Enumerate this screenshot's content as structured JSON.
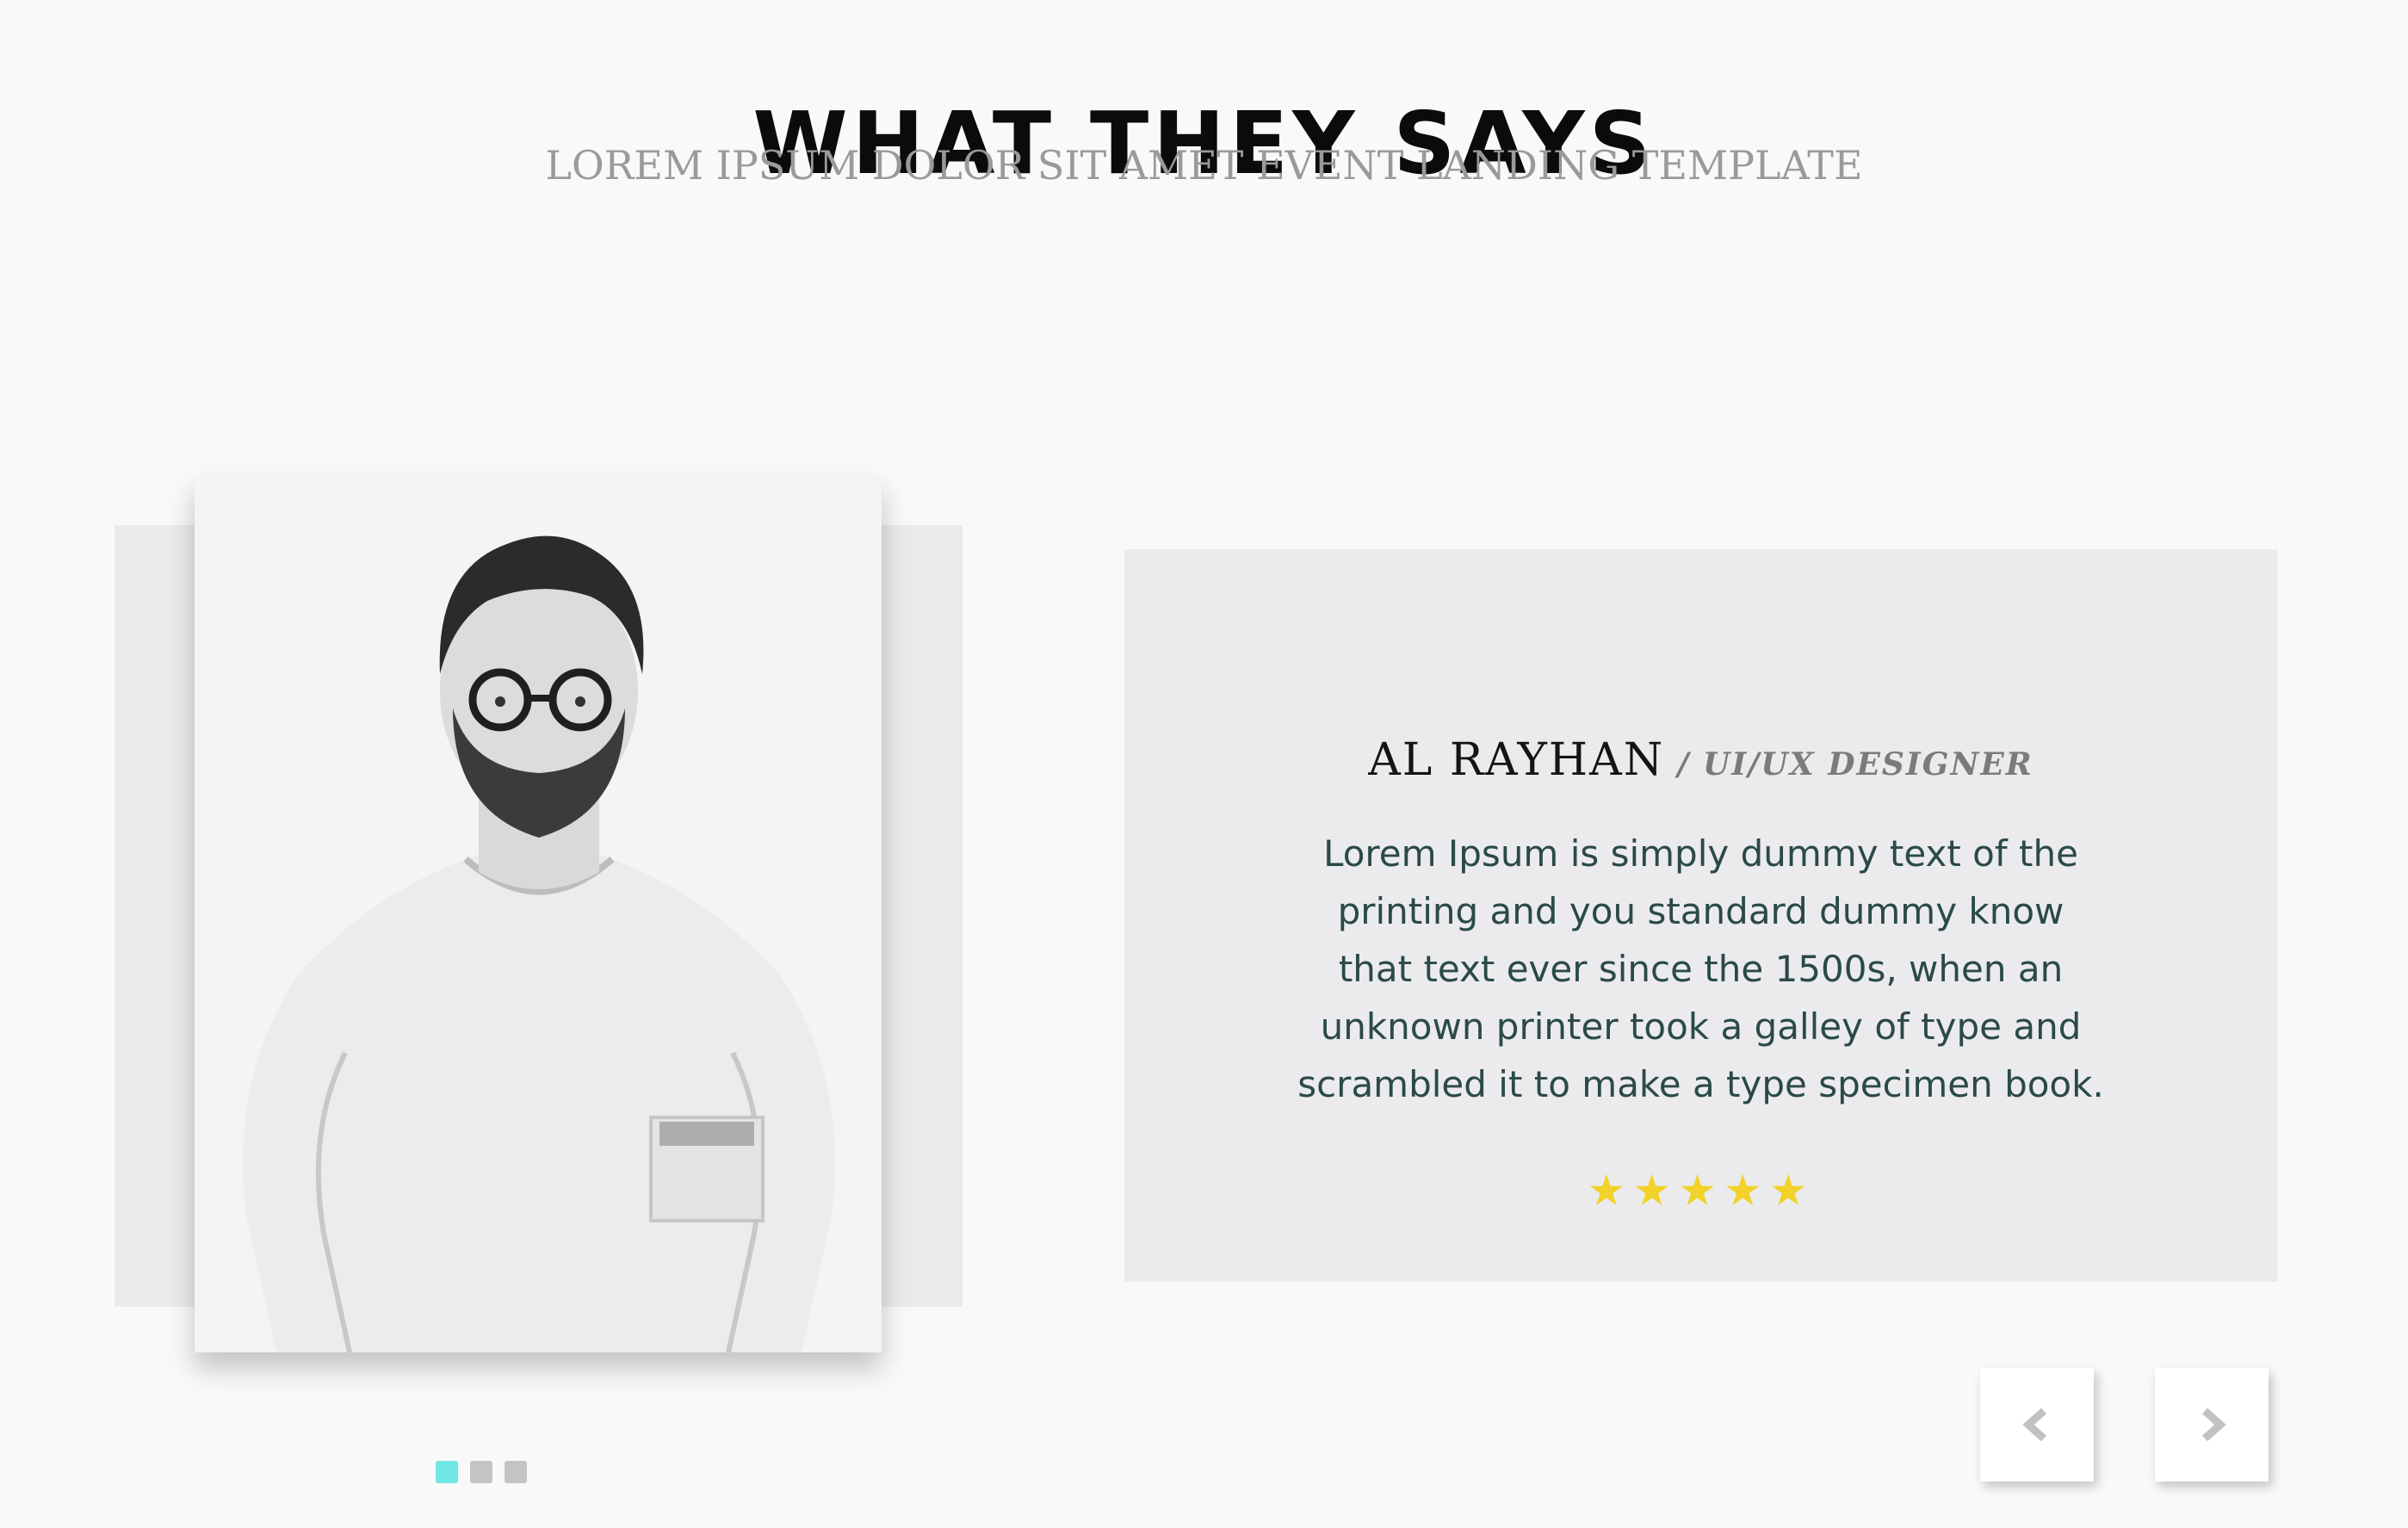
{
  "section": {
    "title": "WHAT THEY SAYS",
    "subtitle": "LOREM IPSUM DOLOR SIT AMET EVENT LANDING TEMPLATE"
  },
  "testimonial": {
    "name": "AL RAYHAN",
    "role": "/ UI/UX DESIGNER",
    "text": "Lorem Ipsum is simply dummy text of the printing and you standard dummy know that text ever since the 1500s, when an unknown printer took a galley of type and scrambled it to make a type specimen book.",
    "rating": 5,
    "stars_display": "★★★★★",
    "photo": "portrait-photo"
  },
  "slider": {
    "pages": 3,
    "active_page": 1
  },
  "controls": {
    "prev_icon": "chevron-left-icon",
    "next_icon": "chevron-right-icon"
  },
  "colors": {
    "background": "#f8f9f9",
    "card": "#ebebed",
    "star": "#f2d229",
    "active_dot": "#6fe7e7",
    "inactive_dot": "#c4c4c4"
  }
}
